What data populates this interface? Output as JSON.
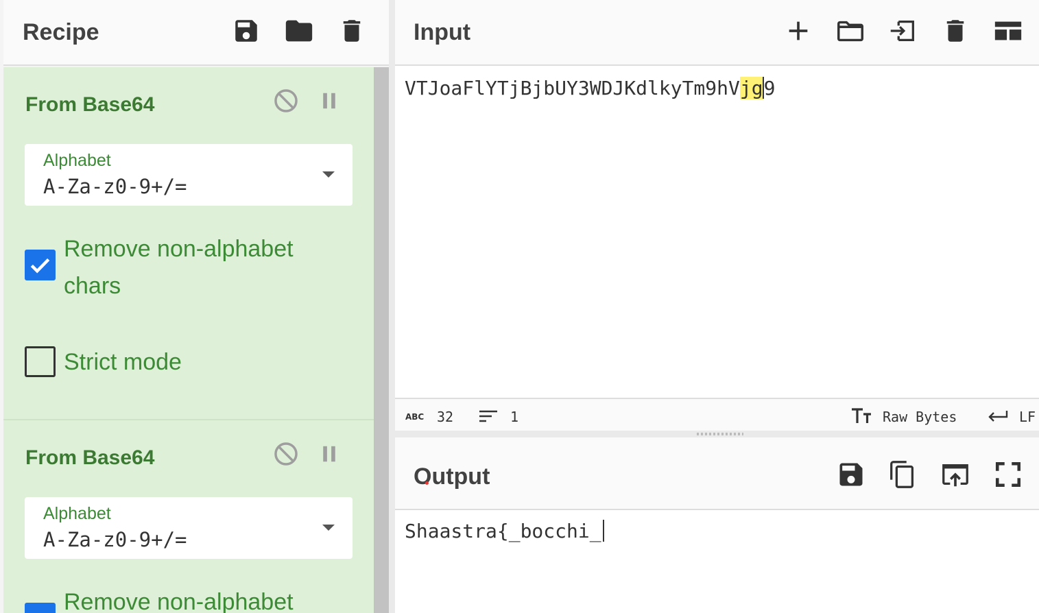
{
  "recipe": {
    "title": "Recipe",
    "operations": [
      {
        "name": "From Base64",
        "alphabet_label": "Alphabet",
        "alphabet_value": "A-Za-z0-9+/=",
        "remove_non_alphabet_label": "Remove non-alphabet chars",
        "remove_non_alphabet_checked": true,
        "strict_mode_label": "Strict mode",
        "strict_mode_checked": false
      },
      {
        "name": "From Base64",
        "alphabet_label": "Alphabet",
        "alphabet_value": "A-Za-z0-9+/=",
        "remove_non_alphabet_label": "Remove non-alphabet",
        "remove_non_alphabet_checked": true
      }
    ]
  },
  "input": {
    "title": "Input",
    "text_before": "VTJoaFlYTjBjbUY3WDJKdlkyTm9hV",
    "text_highlight": "jg",
    "text_after": "9",
    "status": {
      "length": "32",
      "lines": "1",
      "encoding": "Raw Bytes",
      "eol": "LF"
    }
  },
  "output": {
    "title": "Output",
    "text": "Shaastra{_bocchi_"
  },
  "colors": {
    "recipe_bg": "#dff0d8",
    "recipe_text": "#3c8a36",
    "checkbox_on": "#1a73e8",
    "highlight": "#fff176"
  }
}
